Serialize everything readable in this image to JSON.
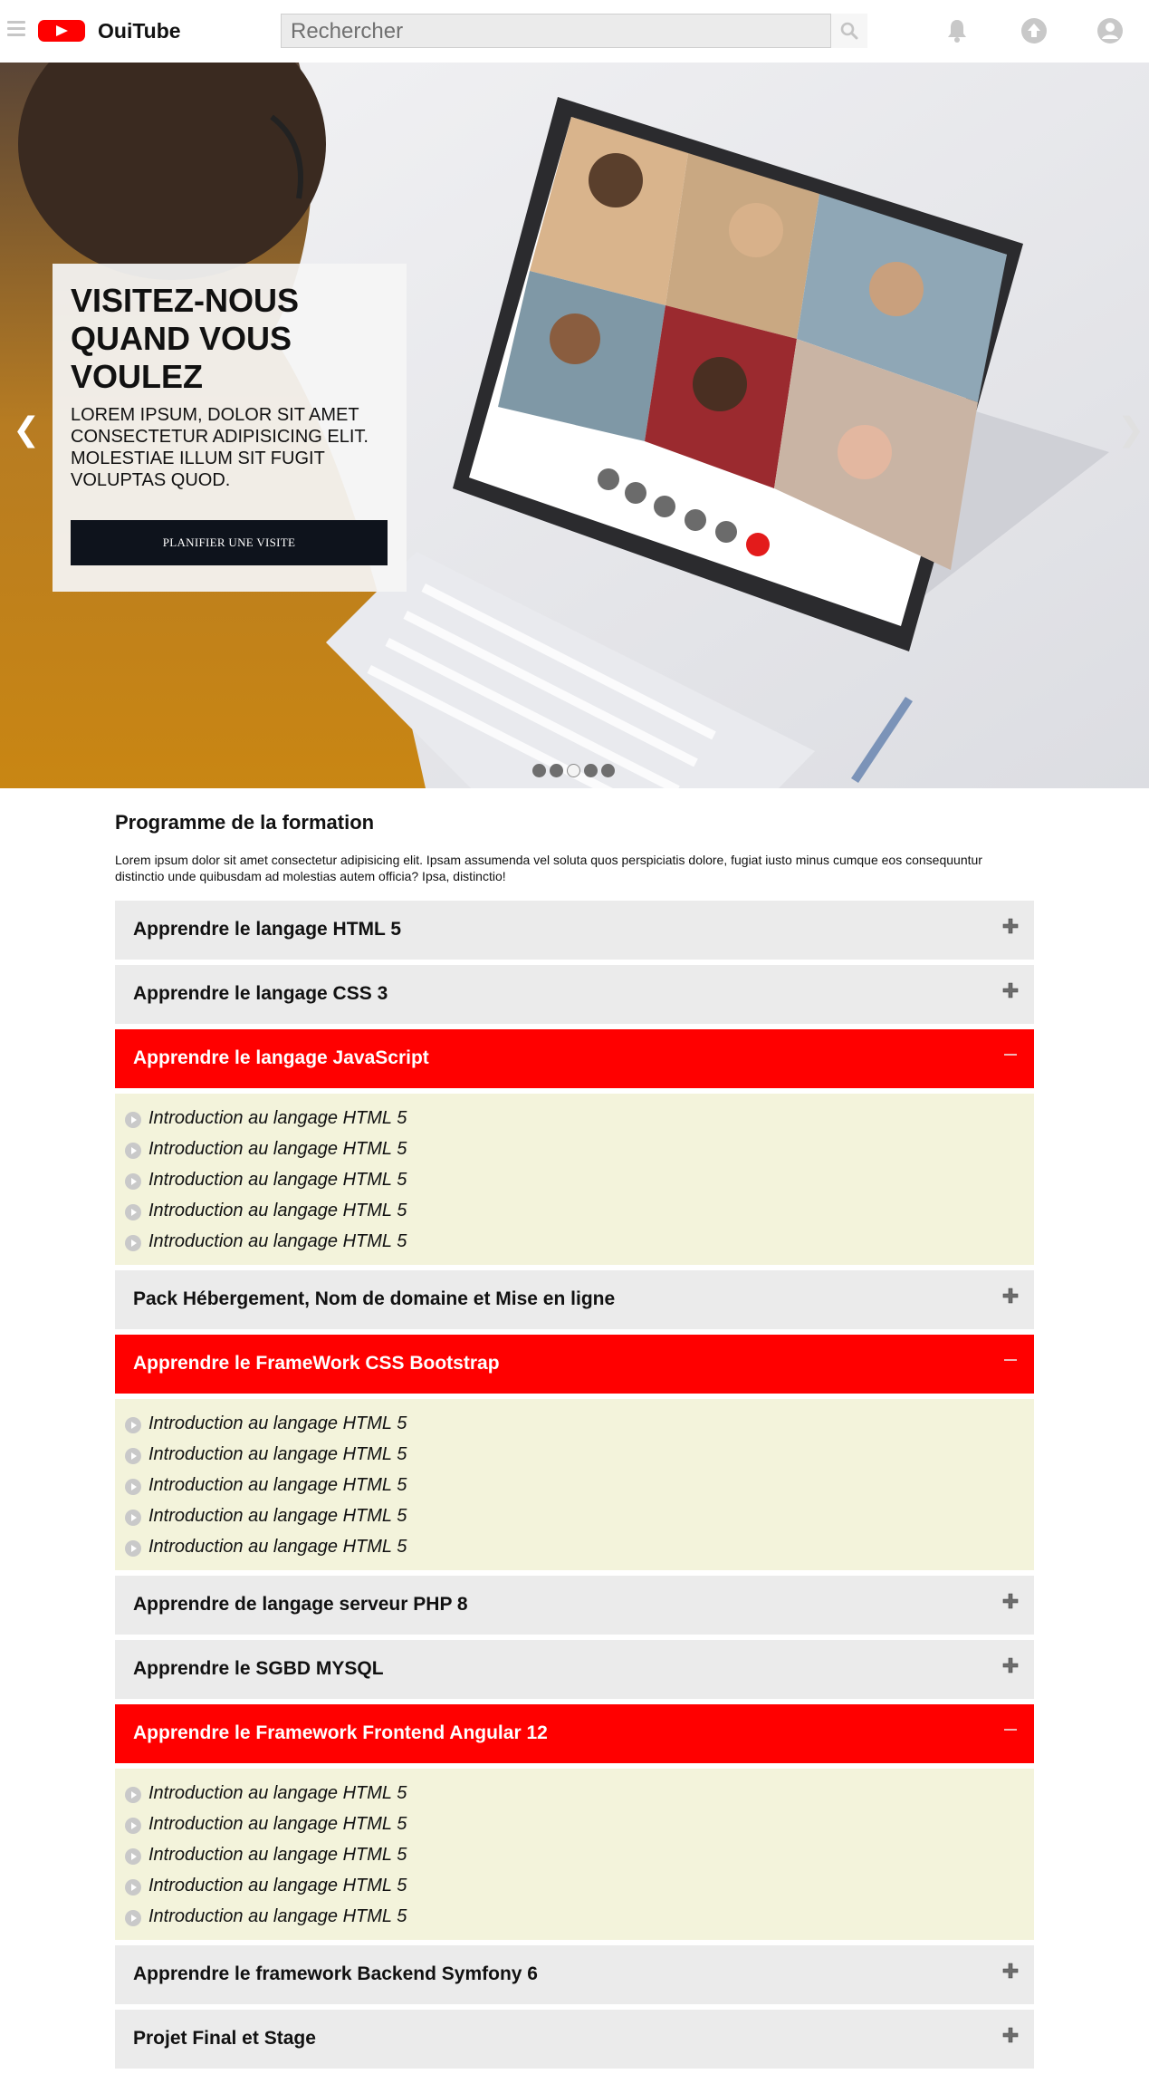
{
  "header": {
    "brand": "OuiTube",
    "search_placeholder": "Rechercher"
  },
  "hero": {
    "title": "VISITEZ-NOUS QUAND VOUS VOULEZ",
    "subtitle": "LOREM IPSUM, DOLOR SIT AMET CONSECTETUR ADIPISICING ELIT. MOLESTIAE ILLUM SIT FUGIT VOLUPTAS QUOD.",
    "cta_label": "PLANIFIER UNE VISITE",
    "prev_arrow": "❮",
    "next_arrow": "❯",
    "slide_count": 5,
    "active_slide": 3
  },
  "program": {
    "title": "Programme de la formation",
    "intro": "Lorem ipsum dolor sit amet consectetur adipisicing elit. Ipsam assumenda vel soluta quos perspiciatis dolore, fugiat iusto minus cumque eos consequuntur distinctio unde quibusdam ad molestias autem officia? Ipsa, distinctio!",
    "modules": [
      {
        "label": "Apprendre le langage HTML 5",
        "open": false
      },
      {
        "label": "Apprendre le langage CSS 3",
        "open": false
      },
      {
        "label": "Apprendre le langage JavaScript",
        "open": true,
        "lessons": [
          "Introduction au langage HTML 5",
          "Introduction au langage HTML 5",
          "Introduction au langage HTML 5",
          "Introduction au langage HTML 5",
          "Introduction au langage HTML 5"
        ]
      },
      {
        "label": "Pack Hébergement, Nom de domaine et Mise en ligne",
        "open": false
      },
      {
        "label": "Apprendre le FrameWork CSS Bootstrap",
        "open": true,
        "lessons": [
          "Introduction au langage HTML 5",
          "Introduction au langage HTML 5",
          "Introduction au langage HTML 5",
          "Introduction au langage HTML 5",
          "Introduction au langage HTML 5"
        ]
      },
      {
        "label": "Apprendre de langage serveur PHP 8",
        "open": false
      },
      {
        "label": "Apprendre le SGBD MYSQL",
        "open": false
      },
      {
        "label": "Apprendre le Framework Frontend Angular 12",
        "open": true,
        "lessons": [
          "Introduction au langage HTML 5",
          "Introduction au langage HTML 5",
          "Introduction au langage HTML 5",
          "Introduction au langage HTML 5",
          "Introduction au langage HTML 5"
        ]
      },
      {
        "label": "Apprendre le framework Backend Symfony 6",
        "open": false
      },
      {
        "label": "Projet Final et Stage",
        "open": false
      }
    ]
  },
  "colors": {
    "brand_red": "#ff0000",
    "accordion_closed_bg": "#ebebeb",
    "accordion_open_bg": "#ff0000",
    "lesson_panel_bg": "#f3f3db",
    "cta_bg": "#0e131c"
  },
  "icons": [
    "menu-icon",
    "logo-play-icon",
    "search-icon",
    "bell-icon",
    "upload-icon",
    "account-icon",
    "plus-icon",
    "minus-icon",
    "play-circle-icon"
  ]
}
